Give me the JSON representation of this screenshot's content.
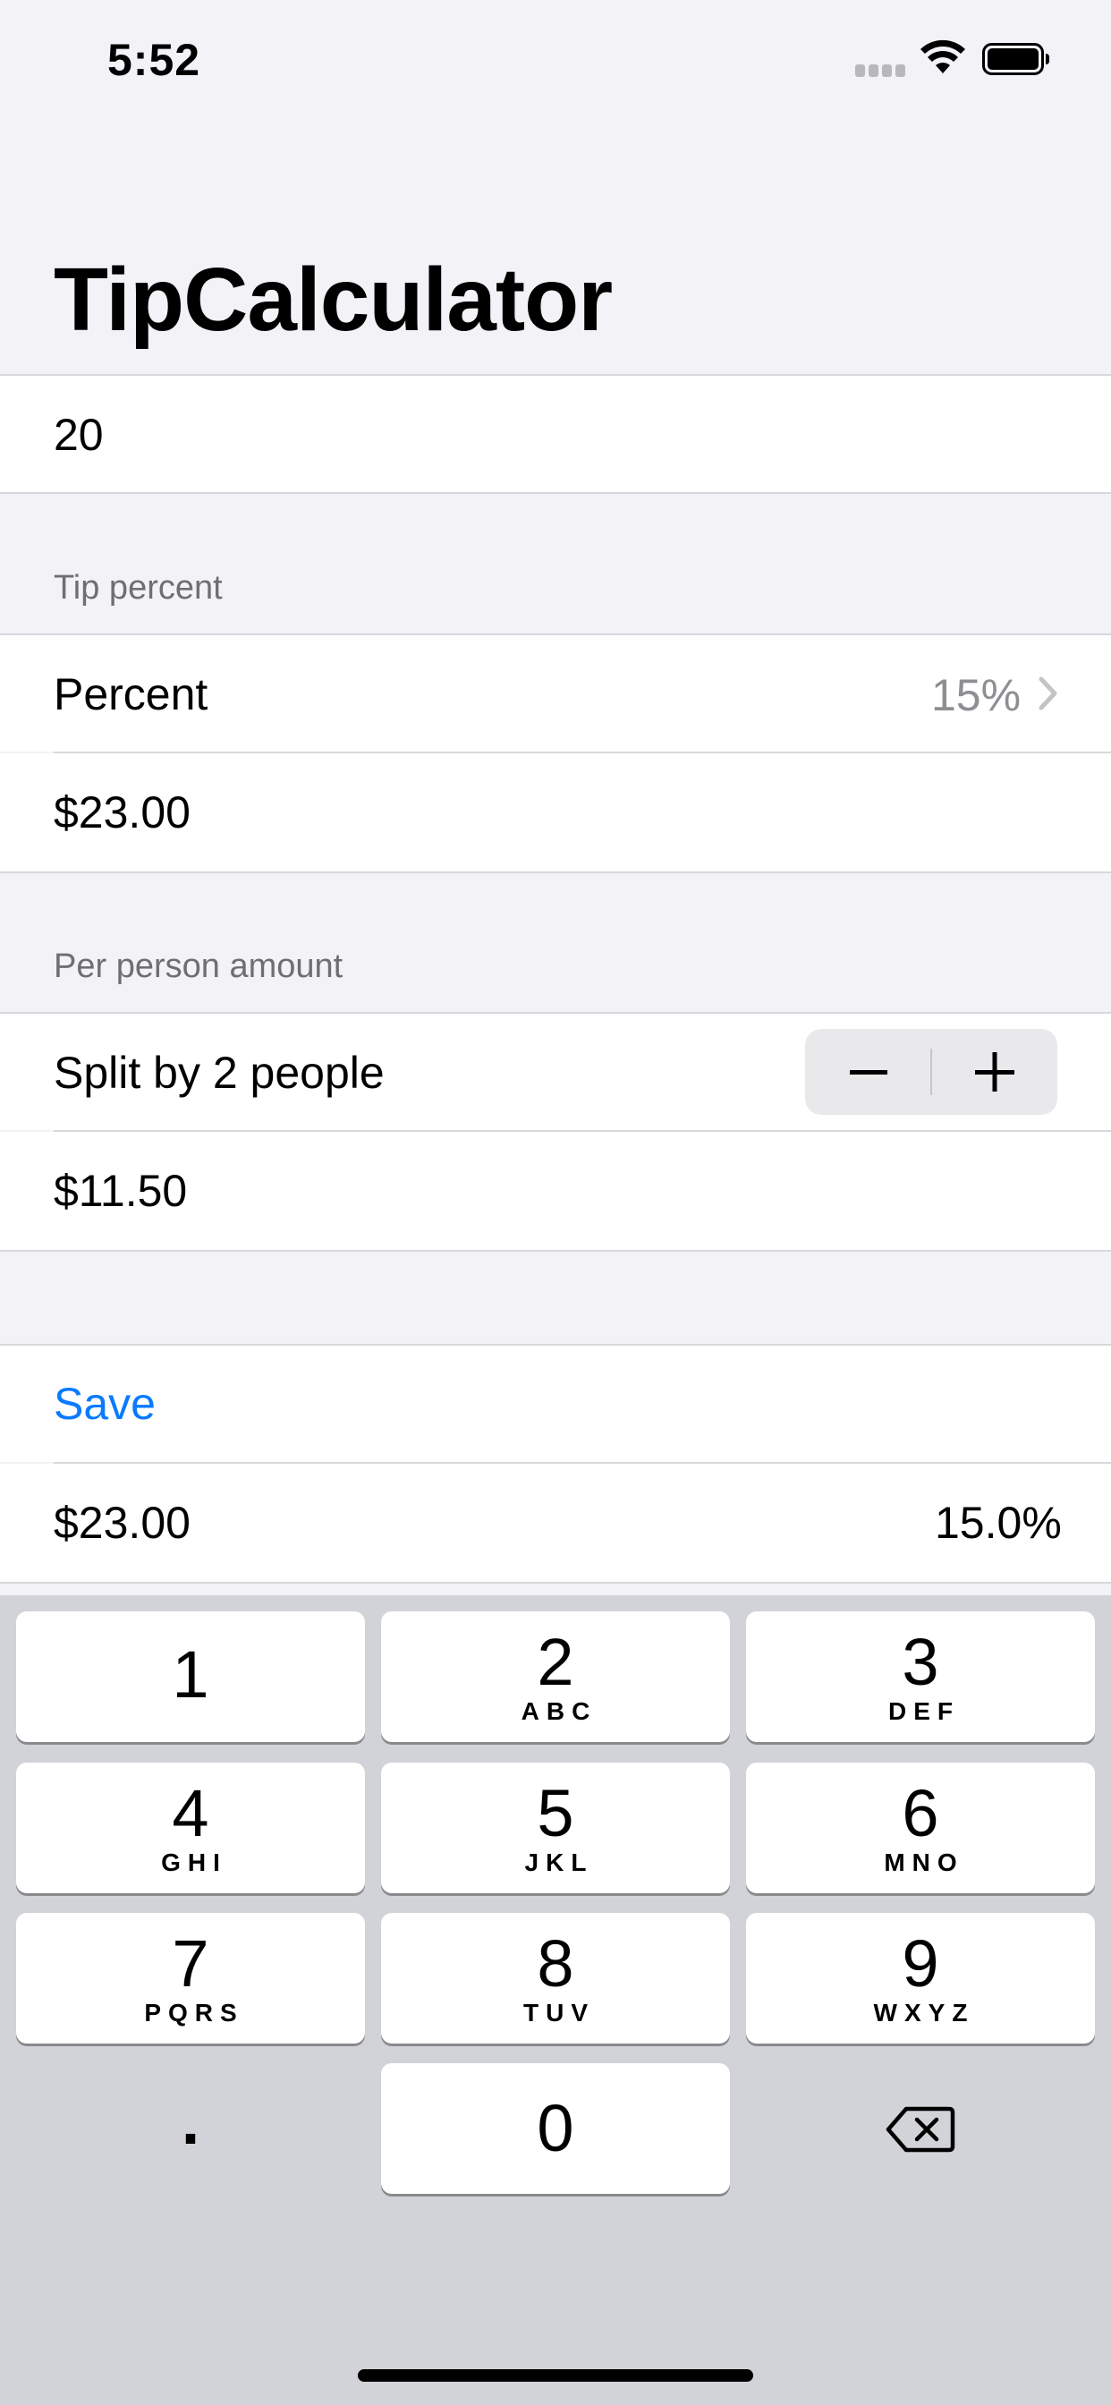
{
  "status_bar": {
    "time": "5:52"
  },
  "nav": {
    "title": "TipCalculator"
  },
  "amount_input": {
    "value": "20"
  },
  "tip_section": {
    "header": "Tip percent",
    "percent_label": "Percent",
    "percent_value": "15%",
    "total_value": "$23.00"
  },
  "per_person_section": {
    "header": "Per person amount",
    "split_label": "Split by 2 people",
    "per_person_value": "$11.50"
  },
  "save_section": {
    "save_label": "Save",
    "saved_total": "$23.00",
    "saved_percent": "15.0%"
  },
  "keyboard": {
    "keys": [
      {
        "num": "1",
        "letters": ""
      },
      {
        "num": "2",
        "letters": "ABC"
      },
      {
        "num": "3",
        "letters": "DEF"
      },
      {
        "num": "4",
        "letters": "GHI"
      },
      {
        "num": "5",
        "letters": "JKL"
      },
      {
        "num": "6",
        "letters": "MNO"
      },
      {
        "num": "7",
        "letters": "PQRS"
      },
      {
        "num": "8",
        "letters": "TUV"
      },
      {
        "num": "9",
        "letters": "WXYZ"
      },
      {
        "num": "0",
        "letters": ""
      }
    ],
    "decimal": "."
  },
  "colors": {
    "accent": "#0a7aff",
    "background": "#f2f2f7",
    "keyboard": "#d1d3d9"
  },
  "icons": [
    "signal-icon",
    "wifi-icon",
    "battery-icon",
    "chevron-right-icon",
    "minus-icon",
    "plus-icon",
    "delete-backspace-icon"
  ]
}
